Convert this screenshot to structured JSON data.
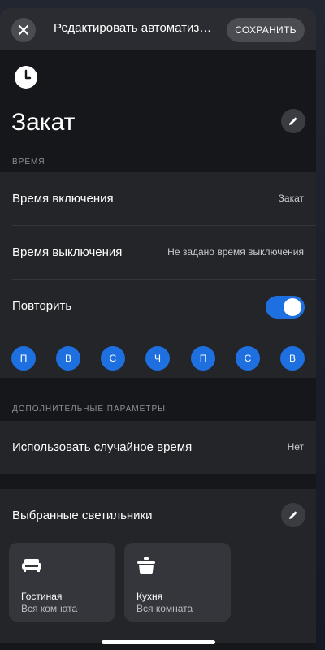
{
  "topbar": {
    "close_icon": "close-icon",
    "title": "Редактировать автоматизацию",
    "save_label": "СОХРАНИТЬ"
  },
  "header": {
    "icon": "clock-icon",
    "title": "Закат",
    "edit_icon": "pencil-icon"
  },
  "time_section": {
    "label": "ВРЕМЯ",
    "on_label": "Время включения",
    "on_value": "Закат",
    "off_label": "Время выключения",
    "off_value": "Не задано время выключения",
    "repeat_label": "Повторить",
    "repeat_enabled": true,
    "days": [
      "П",
      "В",
      "С",
      "Ч",
      "П",
      "С",
      "В"
    ]
  },
  "extra_section": {
    "label": "ДОПОЛНИТЕЛЬНЫЕ ПАРАМЕТРЫ",
    "random_label": "Использовать случайное время",
    "random_value": "Нет"
  },
  "lights_section": {
    "label": "Выбранные светильники",
    "edit_icon": "pencil-icon",
    "rooms": [
      {
        "name": "Гостиная",
        "subtitle": "Вся комната",
        "icon": "sofa-icon"
      },
      {
        "name": "Кухня",
        "subtitle": "Вся комната",
        "icon": "pot-icon"
      }
    ]
  },
  "colors": {
    "accent": "#1e6fe0",
    "background": "#15171b",
    "card": "#232529"
  }
}
